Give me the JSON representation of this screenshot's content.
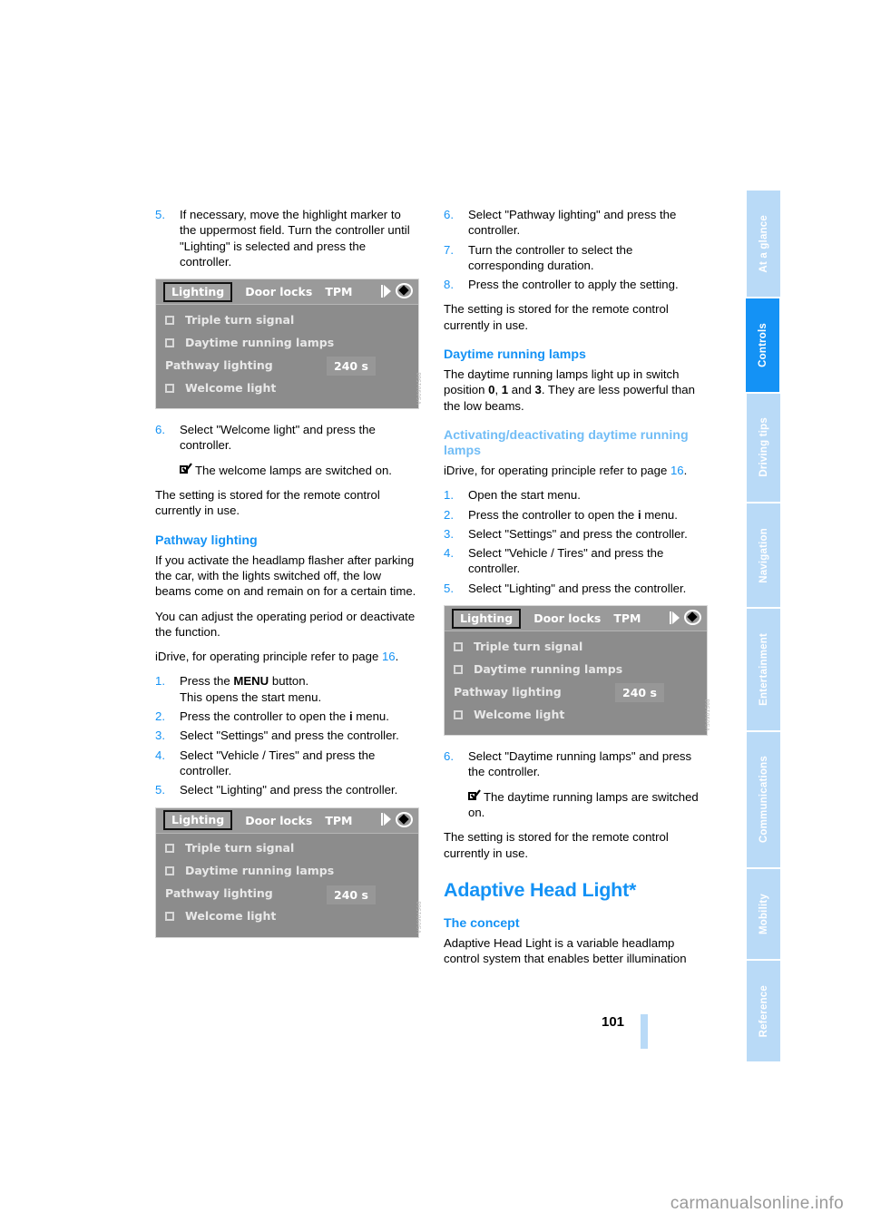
{
  "page": {
    "number": "101",
    "watermark": "carmanualsonline.info"
  },
  "sidebar": {
    "tabs": [
      {
        "label": "At a glance",
        "active": false
      },
      {
        "label": "Controls",
        "active": true
      },
      {
        "label": "Driving tips",
        "active": false
      },
      {
        "label": "Navigation",
        "active": false
      },
      {
        "label": "Entertainment",
        "active": false
      },
      {
        "label": "Communications",
        "active": false
      },
      {
        "label": "Mobility",
        "active": false
      },
      {
        "label": "Reference",
        "active": false
      }
    ],
    "colors": {
      "active_bg": "#1492f5",
      "inactive_bg": "#b9daf7",
      "label": "#ffffff"
    }
  },
  "colors": {
    "heading_blue": "#1492f5",
    "subheading_blue": "#72bdf6",
    "step_number_blue": "#1492f5",
    "page_mark": "#b9daf7"
  },
  "idrive_screen": {
    "tab_selected": "Lighting",
    "tabs": [
      "Door locks",
      "TPM"
    ],
    "icons": [
      "play-icon",
      "diamond-select-icon"
    ],
    "rows": [
      {
        "label": "Triple turn signal",
        "checkbox": true,
        "value": ""
      },
      {
        "label": "Daytime running lamps",
        "checkbox": true,
        "value": ""
      },
      {
        "label": "Pathway lighting",
        "checkbox": false,
        "value": "240 s"
      },
      {
        "label": "Welcome light",
        "checkbox": true,
        "value": ""
      }
    ],
    "caption": "VS0901568"
  },
  "left_column": {
    "step5": {
      "num": "5.",
      "text": "If necessary, move the highlight marker to the uppermost field. Turn the controller until \"Lighting\" is selected and press the controller."
    },
    "step6": {
      "num": "6.",
      "text": "Select \"Welcome light\" and press the controller."
    },
    "result6": "The welcome lamps are switched on.",
    "stored_note": "The setting is stored for the remote control currently in use.",
    "pathway_heading": "Pathway lighting",
    "pathway_p1": "If you activate the headlamp flasher after parking the car, with the lights switched off, the low beams come on and remain on for a certain time.",
    "pathway_p2": "You can adjust the operating period or deactivate the function.",
    "idrive_ref_pre": "iDrive, for operating principle refer to page ",
    "idrive_ref_page": "16",
    "idrive_ref_post": ".",
    "steps": [
      {
        "num": "1.",
        "text_pre": "Press the ",
        "keyword": "MENU",
        "text_post": " button.",
        "sub": "This opens the start menu."
      },
      {
        "num": "2.",
        "text_pre": "Press the controller to open the ",
        "keyword": "i",
        "text_post": " menu.",
        "sub": ""
      },
      {
        "num": "3.",
        "text_pre": "Select \"Settings\" and press the controller.",
        "keyword": "",
        "text_post": "",
        "sub": ""
      },
      {
        "num": "4.",
        "text_pre": "Select \"Vehicle / Tires\" and press the controller.",
        "keyword": "",
        "text_post": "",
        "sub": ""
      },
      {
        "num": "5.",
        "text_pre": "Select \"Lighting\" and press the controller.",
        "keyword": "",
        "text_post": "",
        "sub": ""
      }
    ]
  },
  "right_column": {
    "steps_top": [
      {
        "num": "6.",
        "text": "Select \"Pathway lighting\" and press the controller."
      },
      {
        "num": "7.",
        "text": "Turn the controller to select the corresponding duration."
      },
      {
        "num": "8.",
        "text": "Press the controller to apply the setting."
      }
    ],
    "stored_note": "The setting is stored for the remote control currently in use.",
    "drl_heading": "Daytime running lamps",
    "drl_p1_a": "The daytime running lamps light up in switch position ",
    "drl_pos1": "0",
    "drl_p1_b": ", ",
    "drl_pos2": "1",
    "drl_p1_c": " and ",
    "drl_pos3": "3",
    "drl_p1_d": ". They are less powerful than the low beams.",
    "act_heading": "Activating/deactivating daytime running lamps",
    "idrive_ref_pre": "iDrive, for operating principle refer to page ",
    "idrive_ref_page": "16",
    "idrive_ref_post": ".",
    "steps": [
      {
        "num": "1.",
        "text_pre": "Open the start menu.",
        "keyword": "",
        "text_post": ""
      },
      {
        "num": "2.",
        "text_pre": "Press the controller to open the ",
        "keyword": "i",
        "text_post": " menu."
      },
      {
        "num": "3.",
        "text_pre": "Select \"Settings\" and press the controller.",
        "keyword": "",
        "text_post": ""
      },
      {
        "num": "4.",
        "text_pre": "Select \"Vehicle / Tires\" and press the controller.",
        "keyword": "",
        "text_post": ""
      },
      {
        "num": "5.",
        "text_pre": "Select \"Lighting\" and press the controller.",
        "keyword": "",
        "text_post": ""
      }
    ],
    "step6": {
      "num": "6.",
      "text": "Select \"Daytime running lamps\" and press the controller."
    },
    "result6": "The daytime running lamps are switched on.",
    "stored_note2": "The setting is stored for the remote control currently in use.",
    "adaptive_heading": "Adaptive Head Light*",
    "concept_heading": "The concept",
    "concept_p1": "Adaptive Head Light is a variable headlamp control system that enables better illumination"
  }
}
